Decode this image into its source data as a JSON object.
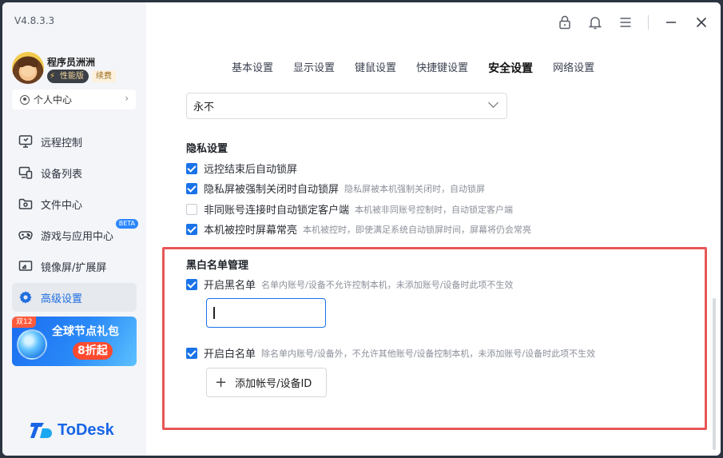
{
  "app": {
    "version": "V4.8.3.3",
    "logo_text": "ToDesk"
  },
  "user": {
    "name": "程序员洲洲",
    "badge_perf": "性能版",
    "badge_renew": "续费",
    "personal_center": "个人中心"
  },
  "sidebar": {
    "items": [
      {
        "label": "远程控制",
        "icon": "monitor-icon"
      },
      {
        "label": "设备列表",
        "icon": "devices-icon"
      },
      {
        "label": "文件中心",
        "icon": "folder-icon"
      },
      {
        "label": "游戏与应用中心",
        "icon": "gamepad-icon",
        "badge": "BETA"
      },
      {
        "label": "镜像屏/扩展屏",
        "icon": "mirror-screen-icon"
      },
      {
        "label": "高级设置",
        "icon": "gear-icon",
        "active": true
      }
    ]
  },
  "promo": {
    "tag": "双12",
    "title": "全球节点礼包",
    "discount": "8折起"
  },
  "tabs": [
    {
      "label": "基本设置"
    },
    {
      "label": "显示设置"
    },
    {
      "label": "键鼠设置"
    },
    {
      "label": "快捷键设置"
    },
    {
      "label": "安全设置",
      "active": true
    },
    {
      "label": "网络设置"
    }
  ],
  "dropdown": {
    "value": "永不"
  },
  "privacy": {
    "title": "隐私设置",
    "options": [
      {
        "label": "远控结束后自动锁屏",
        "hint": "",
        "checked": true
      },
      {
        "label": "隐私屏被强制关闭时自动锁屏",
        "hint": "隐私屏被本机强制关闭时，自动锁屏",
        "checked": true
      },
      {
        "label": "非同账号连接时自动锁定客户端",
        "hint": "本机被非同账号控制时，自动锁定客户端",
        "checked": false
      },
      {
        "label": "本机被控时屏幕常亮",
        "hint": "本机被控时，即使满足系统自动锁屏时间，屏幕将仍会常亮",
        "checked": true
      }
    ]
  },
  "blackwhite": {
    "title": "黑白名单管理",
    "blacklist_label": "开启黑名单",
    "blacklist_hint": "名单内账号/设备不允许控制本机，未添加账号/设备时此项不生效",
    "blacklist_checked": true,
    "input_value": "",
    "whitelist_label": "开启白名单",
    "whitelist_hint": "除名单内账号/设备外，不允许其他账号/设备控制本机，未添加账号/设备时此项不生效",
    "whitelist_checked": true,
    "add_button": "添加帐号/设备ID"
  },
  "colors": {
    "accent": "#1a73e8",
    "highlight_box": "#e85656",
    "brand": "#1865e6"
  }
}
